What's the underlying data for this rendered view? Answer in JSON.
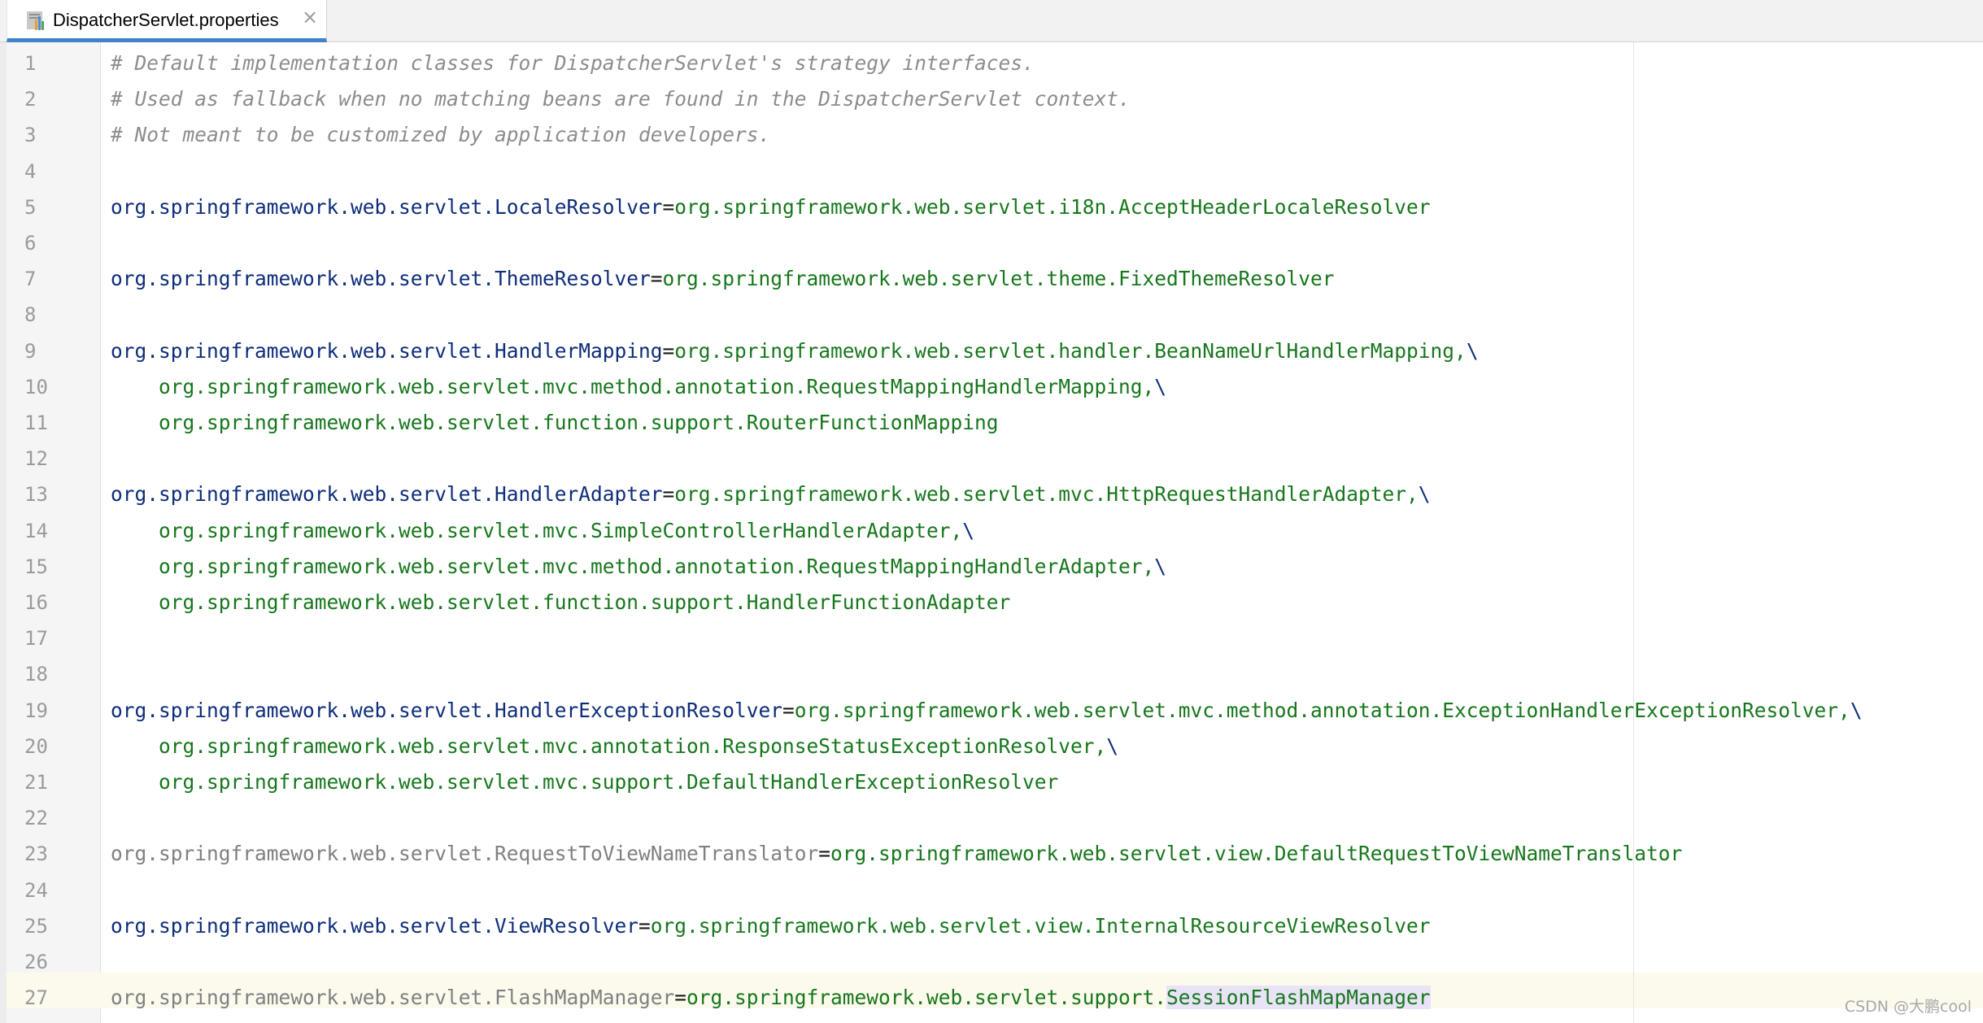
{
  "tab": {
    "label": "DispatcherServlet.properties",
    "icon": "properties-file-icon",
    "close_glyph": "×",
    "accent_color": "#4083c9"
  },
  "colors": {
    "comment": "#8c8c8c",
    "key": "#0e2d7a",
    "value": "#17771c",
    "highlight": "#e9e3f8",
    "caret_row": "#fcfaed"
  },
  "lines": [
    {
      "num": "1",
      "comment": "# Default implementation classes for DispatcherServlet's strategy interfaces."
    },
    {
      "num": "2",
      "comment": "# Used as fallback when no matching beans are found in the DispatcherServlet context."
    },
    {
      "num": "3",
      "comment": "# Not meant to be customized by application developers."
    },
    {
      "num": "4"
    },
    {
      "num": "5",
      "key": "org.springframework.web.servlet.LocaleResolver",
      "eq": "=",
      "value": "org.springframework.web.servlet.i18n.AcceptHeaderLocaleResolver"
    },
    {
      "num": "6"
    },
    {
      "num": "7",
      "key": "org.springframework.web.servlet.ThemeResolver",
      "eq": "=",
      "value": "org.springframework.web.servlet.theme.FixedThemeResolver"
    },
    {
      "num": "8"
    },
    {
      "num": "9",
      "key": "org.springframework.web.servlet.HandlerMapping",
      "eq": "=",
      "value": "org.springframework.web.servlet.handler.BeanNameUrlHandlerMapping,",
      "bs": "\\"
    },
    {
      "num": "10",
      "indent": "    ",
      "value": "org.springframework.web.servlet.mvc.method.annotation.RequestMappingHandlerMapping,",
      "bs": "\\"
    },
    {
      "num": "11",
      "indent": "    ",
      "value": "org.springframework.web.servlet.function.support.RouterFunctionMapping"
    },
    {
      "num": "12"
    },
    {
      "num": "13",
      "key": "org.springframework.web.servlet.HandlerAdapter",
      "eq": "=",
      "value": "org.springframework.web.servlet.mvc.HttpRequestHandlerAdapter,",
      "bs": "\\"
    },
    {
      "num": "14",
      "indent": "    ",
      "value": "org.springframework.web.servlet.mvc.SimpleControllerHandlerAdapter,",
      "bs": "\\"
    },
    {
      "num": "15",
      "indent": "    ",
      "value": "org.springframework.web.servlet.mvc.method.annotation.RequestMappingHandlerAdapter,",
      "bs": "\\"
    },
    {
      "num": "16",
      "indent": "    ",
      "value": "org.springframework.web.servlet.function.support.HandlerFunctionAdapter"
    },
    {
      "num": "17"
    },
    {
      "num": "18"
    },
    {
      "num": "19",
      "key": "org.springframework.web.servlet.HandlerExceptionResolver",
      "eq": "=",
      "value": "org.springframework.web.servlet.mvc.method.annotation.ExceptionHandlerExceptionResolver,",
      "bs": "\\"
    },
    {
      "num": "20",
      "indent": "    ",
      "value": "org.springframework.web.servlet.mvc.annotation.ResponseStatusExceptionResolver,",
      "bs": "\\"
    },
    {
      "num": "21",
      "indent": "    ",
      "value": "org.springframework.web.servlet.mvc.support.DefaultHandlerExceptionResolver"
    },
    {
      "num": "22"
    },
    {
      "num": "23",
      "key_gray": "org.springframework.web.servlet.RequestToViewNameTranslator",
      "eq": "=",
      "value": "org.springframework.web.servlet.view.DefaultRequestToViewNameTranslator"
    },
    {
      "num": "24"
    },
    {
      "num": "25",
      "key": "org.springframework.web.servlet.ViewResolver",
      "eq": "=",
      "value": "org.springframework.web.servlet.view.InternalResourceViewResolver"
    },
    {
      "num": "26"
    },
    {
      "num": "27",
      "key_gray": "org.springframework.web.servlet.FlashMapManager",
      "eq": "=",
      "value": "org.springframework.web.servlet.support.",
      "value_hl": "SessionFlashMapManager"
    }
  ],
  "watermark": "CSDN @大鹏cool"
}
